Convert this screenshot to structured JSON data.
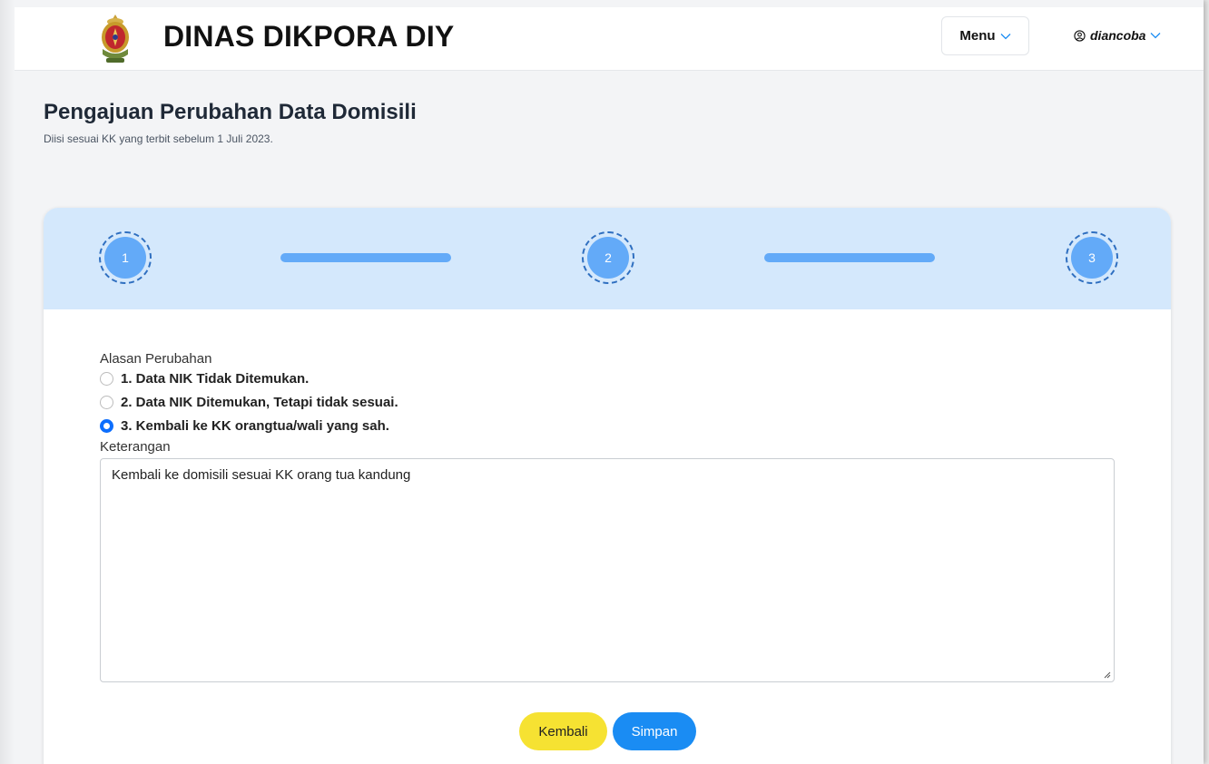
{
  "header": {
    "brand": "DINAS DIKPORA DIY",
    "menu_label": "Menu",
    "username": "diancoba"
  },
  "page": {
    "title": "Pengajuan Perubahan Data Domisili",
    "subtitle": "Diisi sesuai KK yang terbit sebelum 1 Juli 2023."
  },
  "stepper": {
    "steps": [
      "1",
      "2",
      "3"
    ]
  },
  "form": {
    "reason_label": "Alasan Perubahan",
    "reasons": [
      {
        "label": "1. Data NIK Tidak Ditemukan.",
        "selected": false
      },
      {
        "label": "2. Data NIK Ditemukan, Tetapi tidak sesuai.",
        "selected": false
      },
      {
        "label": "3. Kembali ke KK orangtua/wali yang sah.",
        "selected": true
      }
    ],
    "note_label": "Keterangan",
    "note_value": "Kembali ke domisili sesuai KK orang tua kandung"
  },
  "buttons": {
    "back": "Kembali",
    "save": "Simpan"
  },
  "colors": {
    "accent": "#1a8cf3",
    "stepper_bg": "#d4e8fc",
    "step_fill": "#63aaf8",
    "back_button": "#f6e232"
  }
}
